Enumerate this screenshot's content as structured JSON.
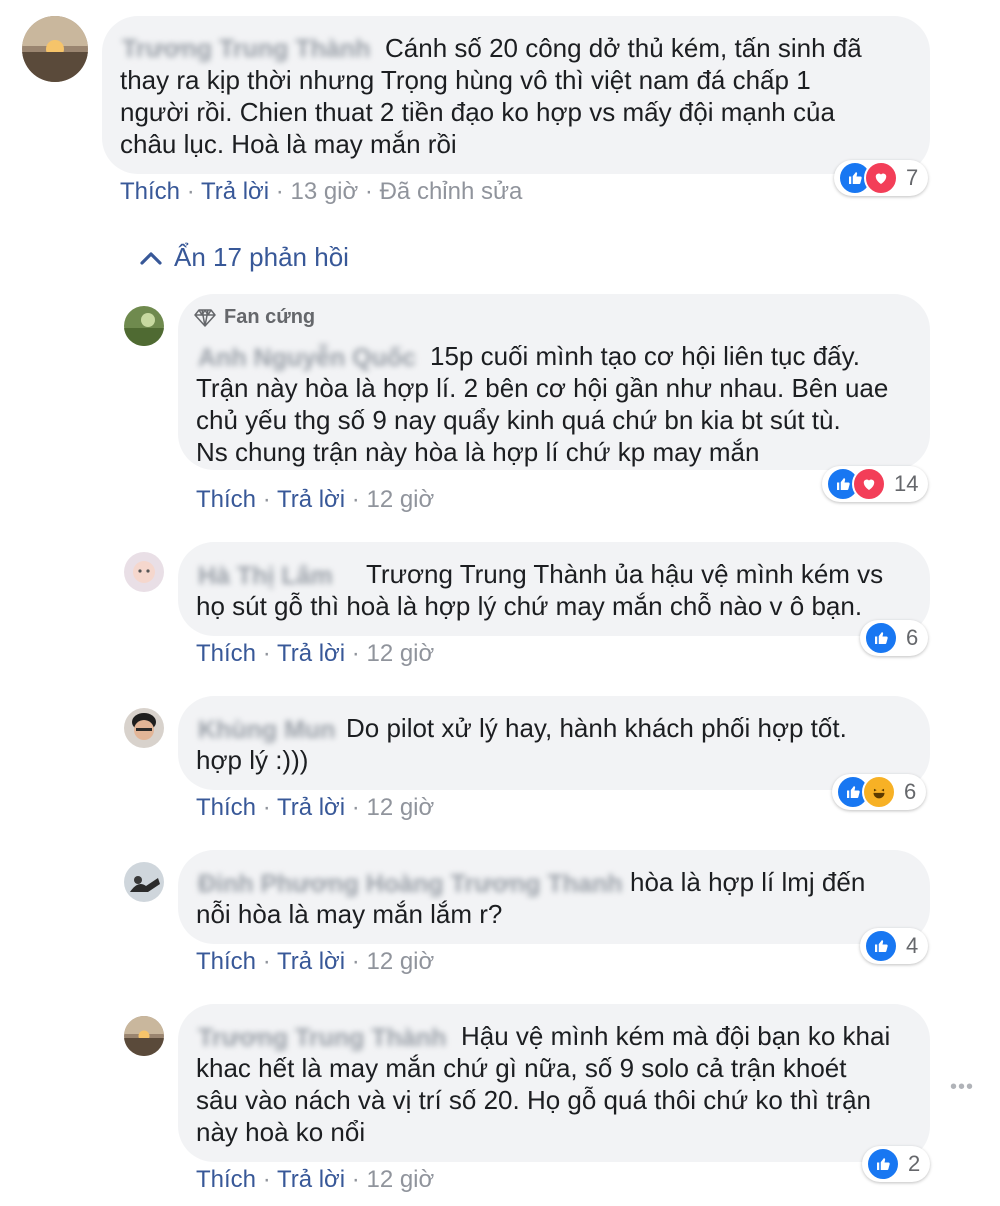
{
  "main_comment": {
    "author": "Trương Trung Thành",
    "text": "Cánh số 20 công dở thủ kém, tấn sinh đã\nthay ra kịp thời nhưng Trọng hùng vô thì việt nam đá chấp 1\nngười rồi. Chien thuat 2 tiền đạo ko hợp vs mấy đội mạnh của\nchâu lục. Hoà là may mắn rồi",
    "like_label": "Thích",
    "reply_label": "Trả lời",
    "time": "13 giờ",
    "edited": "Đã chỉnh sửa",
    "reaction_count": "7",
    "reactions": [
      "like-icon",
      "love-icon"
    ]
  },
  "toggle": {
    "label": "Ẩn 17 phản hồi"
  },
  "replies": [
    {
      "badge": "Fan cứng",
      "author": "Anh Nguyễn Quốc",
      "text": "15p cuối mình tạo cơ hội liên tục đấy.\nTrận này hòa là hợp lí. 2 bên cơ hội gần như nhau. Bên uae\nchủ yếu thg số 9 nay quẩy kinh quá chứ bn kia bt sút tù.\nNs chung trận này hòa là hợp lí chứ kp may mắn",
      "like_label": "Thích",
      "reply_label": "Trả lời",
      "time": "12 giờ",
      "reaction_count": "14",
      "reactions": [
        "like-icon",
        "love-icon"
      ]
    },
    {
      "author": "Hà Thị Lâm",
      "text": "Trương Trung Thành ủa hậu vệ mình kém vs\nhọ sút gỗ thì hoà là hợp lý chứ may mắn chỗ nào v ô bạn.",
      "like_label": "Thích",
      "reply_label": "Trả lời",
      "time": "12 giờ",
      "reaction_count": "6",
      "reactions": [
        "like-icon"
      ]
    },
    {
      "author": "Khùng Mun",
      "text": "Do pilot xử lý hay, hành khách phối hợp tốt.\nhợp lý :)))",
      "like_label": "Thích",
      "reply_label": "Trả lời",
      "time": "12 giờ",
      "reaction_count": "6",
      "reactions": [
        "like-icon",
        "haha-icon"
      ]
    },
    {
      "author": "Đinh Phương Hoàng Trương Thanh",
      "text": "hòa là hợp lí lmj đến\nnỗi hòa là may mắn lắm r?",
      "like_label": "Thích",
      "reply_label": "Trả lời",
      "time": "12 giờ",
      "reaction_count": "4",
      "reactions": [
        "like-icon"
      ]
    },
    {
      "author": "Trương Trung Thành",
      "text": "Hậu vệ mình kém mà đội bạn ko khai\nkhac hết là may mắn chứ gì nữa, số 9 solo cả trận khoét\nsâu vào nách và vị trí số 20. Họ gỗ quá thôi chứ ko thì trận\nnày hoà ko nổi",
      "like_label": "Thích",
      "reply_label": "Trả lời",
      "time": "12 giờ",
      "reaction_count": "2",
      "reactions": [
        "like-icon"
      ]
    }
  ],
  "colors": {
    "bubble_bg": "#f2f3f5",
    "link": "#385898",
    "like": "#1877f2",
    "love": "#f33e58",
    "haha": "#f7b125"
  }
}
